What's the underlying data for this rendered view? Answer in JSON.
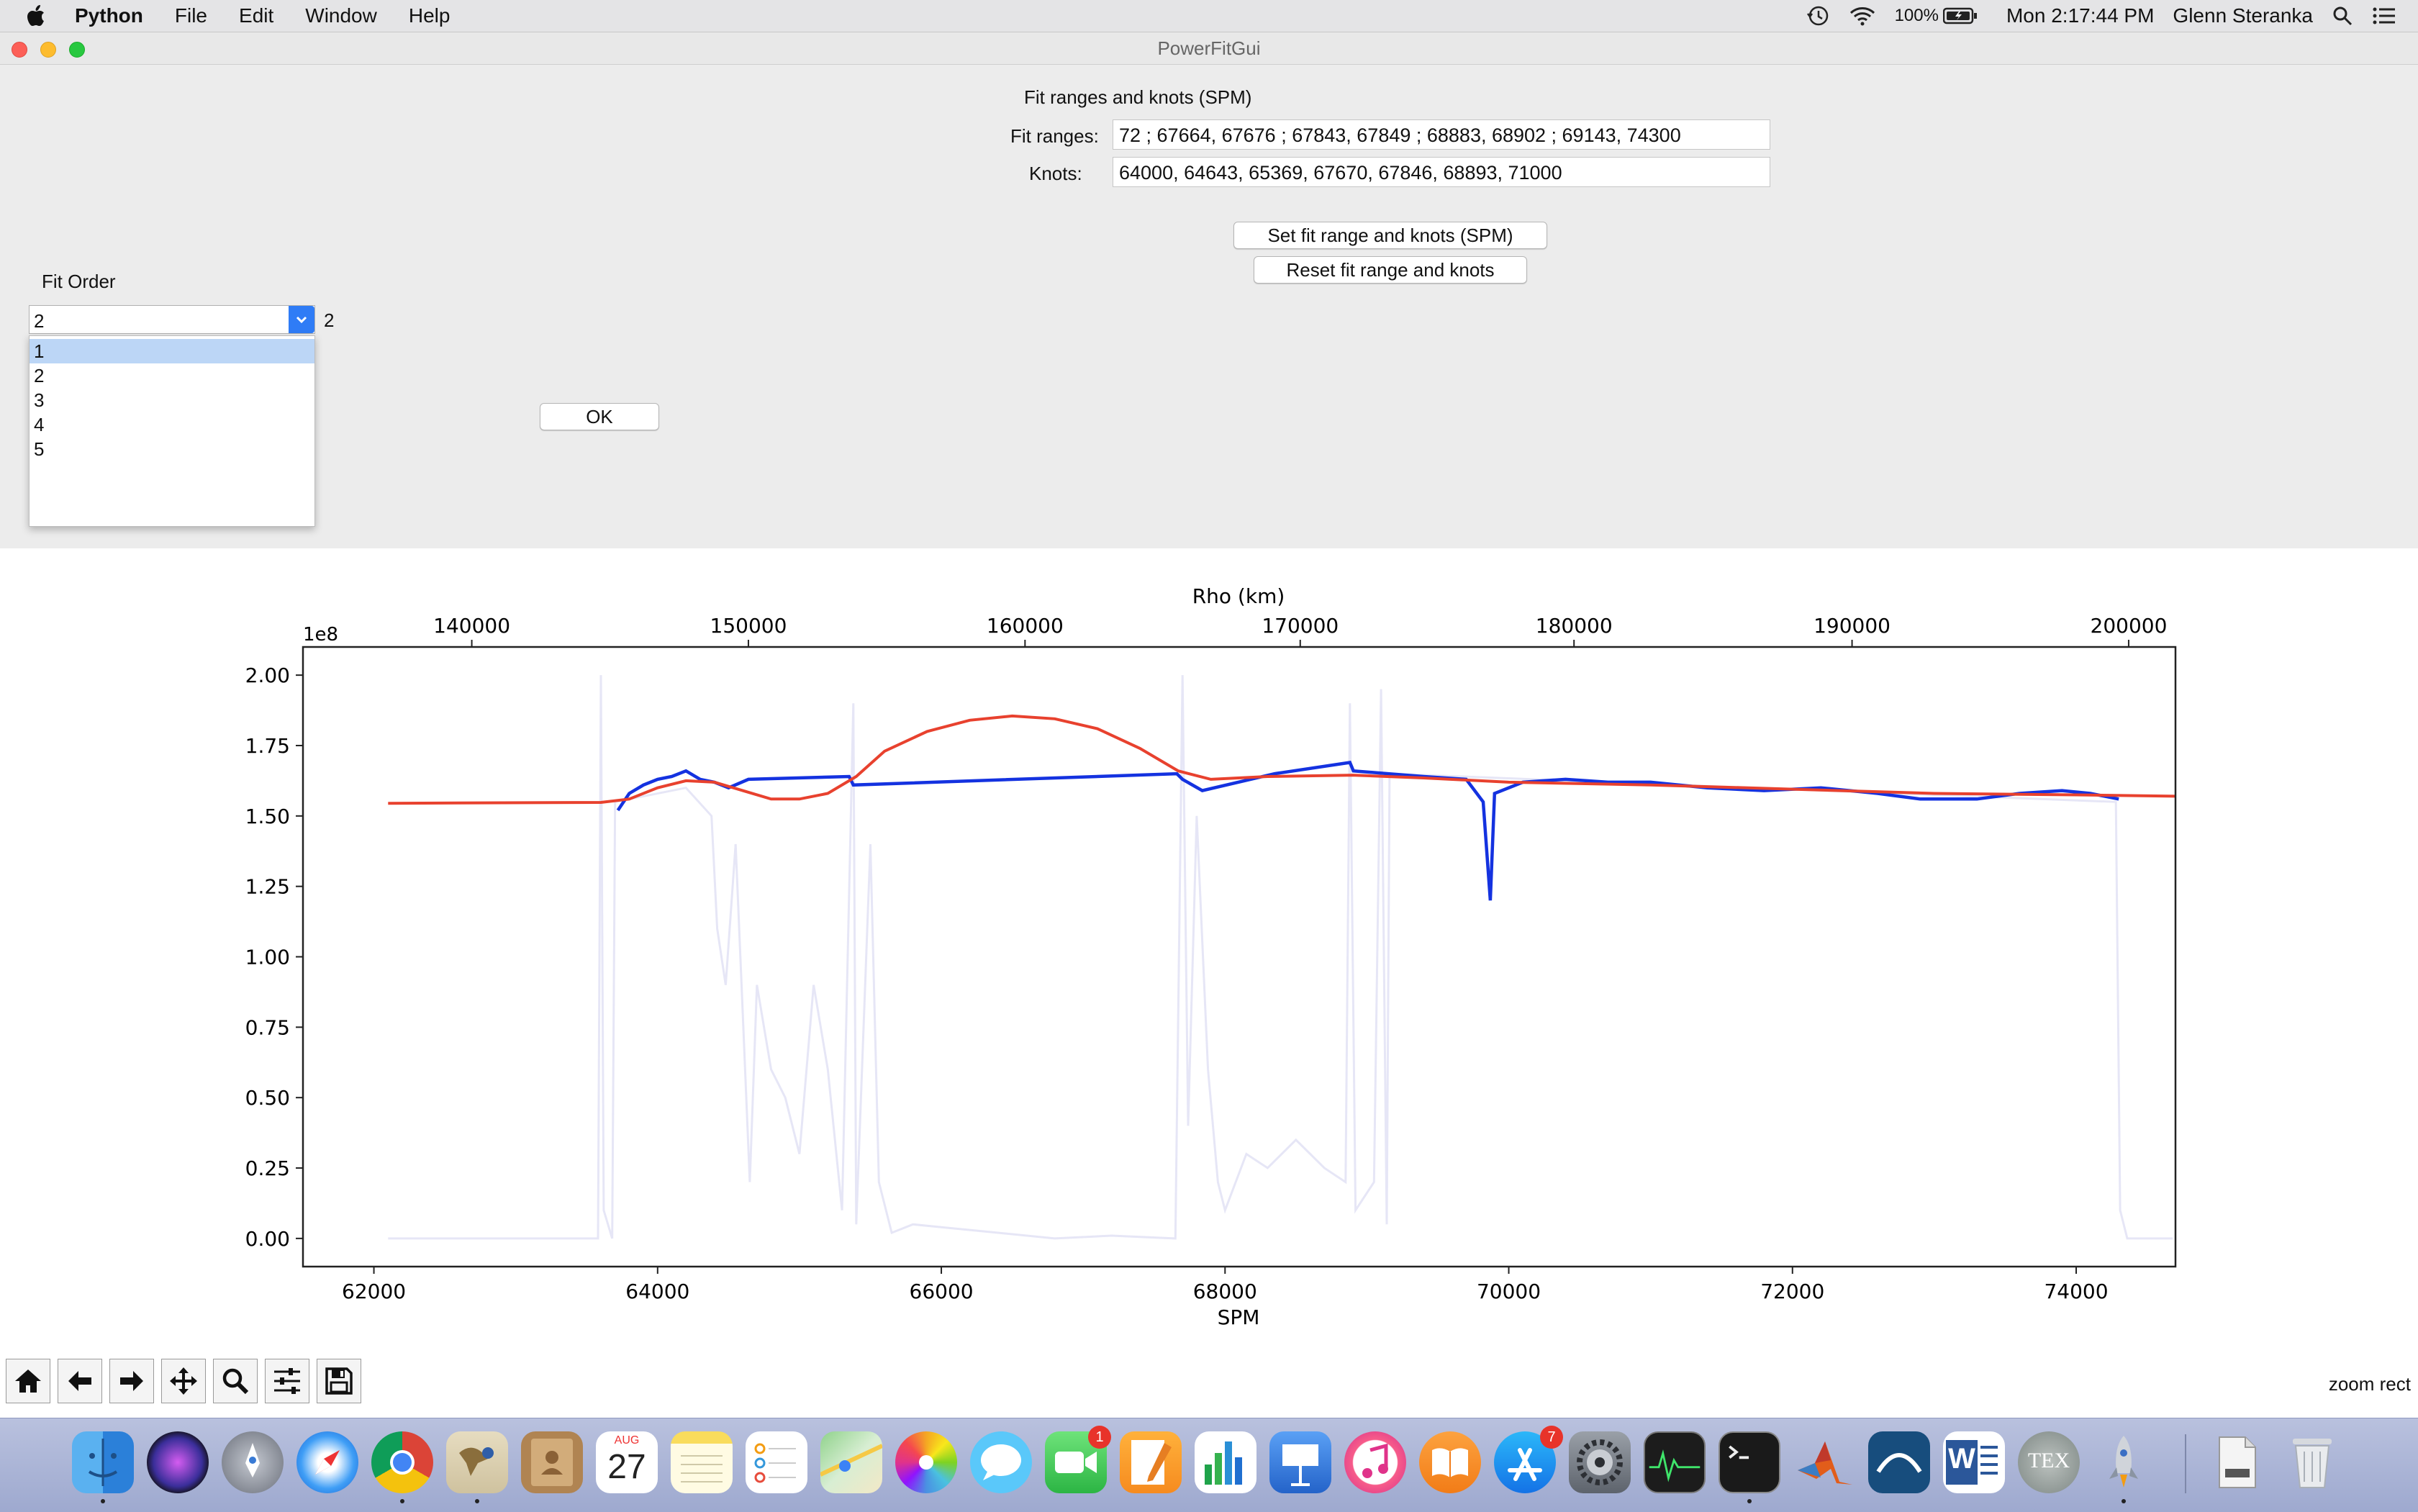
{
  "menubar": {
    "app_name": "Python",
    "menus": [
      "File",
      "Edit",
      "Window",
      "Help"
    ],
    "battery": "100%",
    "clock": "Mon 2:17:44 PM",
    "user": "Glenn Steranka",
    "icons": [
      "time-machine-icon",
      "wifi-icon",
      "battery-icon",
      "spotlight-icon",
      "notification-center-icon"
    ]
  },
  "window": {
    "title": "PowerFitGui"
  },
  "fit_panel": {
    "heading": "Fit ranges and knots (SPM)",
    "fit_ranges_label": "Fit ranges:",
    "fit_ranges_value": "72 ; 67664, 67676 ; 67843, 67849 ; 68883, 68902 ; 69143, 74300",
    "knots_label": "Knots:",
    "knots_value": "64000, 64643, 65369, 67670, 67846, 68893, 71000",
    "set_button": "Set fit range and knots (SPM)",
    "reset_button": "Reset fit range and knots"
  },
  "fit_order": {
    "label": "Fit Order",
    "selected": "2",
    "display_value": "2",
    "options": [
      "1",
      "2",
      "3",
      "4",
      "5"
    ],
    "highlighted": "1"
  },
  "ok_button": "OK",
  "chart_data": {
    "type": "line",
    "title": "",
    "xlabel": "SPM",
    "ylabel": "",
    "top_xlabel": "Rho (km)",
    "y_multiplier": "1e8",
    "xlim": [
      61500,
      74700
    ],
    "ylim": [
      -0.1,
      2.1
    ],
    "x_ticks": [
      62000,
      64000,
      66000,
      68000,
      70000,
      72000,
      74000
    ],
    "x_tick_labels": [
      "62000",
      "64000",
      "66000",
      "68000",
      "70000",
      "72000",
      "74000"
    ],
    "y_ticks": [
      0,
      0.25,
      0.5,
      0.75,
      1.0,
      1.25,
      1.5,
      1.75,
      2.0
    ],
    "y_tick_labels": [
      "0.00",
      "0.25",
      "0.50",
      "0.75",
      "1.00",
      "1.25",
      "1.50",
      "1.75",
      "2.00"
    ],
    "top_ticks": [
      {
        "x": 62690,
        "label": "140000"
      },
      {
        "x": 64640,
        "label": "150000"
      },
      {
        "x": 66590,
        "label": "160000"
      },
      {
        "x": 68530,
        "label": "170000"
      },
      {
        "x": 70460,
        "label": "180000"
      },
      {
        "x": 72420,
        "label": "190000"
      },
      {
        "x": 74370,
        "label": "200000"
      }
    ],
    "grid": false,
    "series": [
      {
        "color": "#e6e6f6",
        "points": [
          [
            62100,
            0.0
          ],
          [
            63580,
            0.0
          ],
          [
            63600,
            2.0
          ],
          [
            63620,
            0.1
          ],
          [
            63680,
            0.0
          ],
          [
            63700,
            1.55
          ],
          [
            64200,
            1.6
          ],
          [
            64380,
            1.5
          ],
          [
            64420,
            1.1
          ],
          [
            64480,
            0.9
          ],
          [
            64550,
            1.4
          ],
          [
            64600,
            0.8
          ],
          [
            64650,
            0.2
          ],
          [
            64700,
            0.9
          ],
          [
            64800,
            0.6
          ],
          [
            64900,
            0.5
          ],
          [
            65000,
            0.3
          ],
          [
            65100,
            0.9
          ],
          [
            65200,
            0.6
          ],
          [
            65300,
            0.1
          ],
          [
            65380,
            1.9
          ],
          [
            65400,
            0.05
          ],
          [
            65500,
            1.4
          ],
          [
            65560,
            0.2
          ],
          [
            65650,
            0.02
          ],
          [
            65800,
            0.05
          ],
          [
            66000,
            0.04
          ],
          [
            66400,
            0.02
          ],
          [
            66800,
            0.0
          ],
          [
            67200,
            0.01
          ],
          [
            67650,
            0.0
          ],
          [
            67700,
            2.0
          ],
          [
            67740,
            0.4
          ],
          [
            67800,
            1.5
          ],
          [
            67880,
            0.6
          ],
          [
            67950,
            0.2
          ],
          [
            68000,
            0.1
          ],
          [
            68150,
            0.3
          ],
          [
            68300,
            0.25
          ],
          [
            68500,
            0.35
          ],
          [
            68700,
            0.25
          ],
          [
            68850,
            0.2
          ],
          [
            68880,
            1.9
          ],
          [
            68920,
            0.1
          ],
          [
            69050,
            0.2
          ],
          [
            69100,
            1.95
          ],
          [
            69140,
            0.05
          ],
          [
            69160,
            1.65
          ],
          [
            74280,
            1.55
          ],
          [
            74310,
            0.1
          ],
          [
            74360,
            0.0
          ],
          [
            74680,
            0.0
          ]
        ]
      },
      {
        "color": "#1432e0",
        "points": [
          [
            63720,
            1.52
          ],
          [
            63800,
            1.58
          ],
          [
            63900,
            1.61
          ],
          [
            64000,
            1.63
          ],
          [
            64100,
            1.64
          ],
          [
            64200,
            1.66
          ],
          [
            64300,
            1.63
          ],
          [
            64400,
            1.62
          ],
          [
            64500,
            1.6
          ],
          [
            64640,
            1.63
          ],
          [
            65350,
            1.64
          ],
          [
            65380,
            1.61
          ],
          [
            67660,
            1.65
          ],
          [
            67700,
            1.63
          ],
          [
            67840,
            1.59
          ],
          [
            68350,
            1.65
          ],
          [
            68880,
            1.69
          ],
          [
            68905,
            1.66
          ],
          [
            69150,
            1.65
          ],
          [
            69400,
            1.64
          ],
          [
            69700,
            1.63
          ],
          [
            69820,
            1.55
          ],
          [
            69870,
            1.2
          ],
          [
            69900,
            1.58
          ],
          [
            70100,
            1.62
          ],
          [
            70400,
            1.63
          ],
          [
            70700,
            1.62
          ],
          [
            71000,
            1.62
          ],
          [
            71400,
            1.6
          ],
          [
            71800,
            1.59
          ],
          [
            72200,
            1.6
          ],
          [
            72600,
            1.58
          ],
          [
            72900,
            1.56
          ],
          [
            73100,
            1.56
          ],
          [
            73300,
            1.56
          ],
          [
            73600,
            1.58
          ],
          [
            73900,
            1.59
          ],
          [
            74100,
            1.58
          ],
          [
            74300,
            1.56
          ]
        ]
      },
      {
        "color": "#e8412e",
        "points": [
          [
            62100,
            1.545
          ],
          [
            63600,
            1.548
          ],
          [
            63800,
            1.56
          ],
          [
            64000,
            1.6
          ],
          [
            64200,
            1.625
          ],
          [
            64400,
            1.62
          ],
          [
            64600,
            1.59
          ],
          [
            64800,
            1.56
          ],
          [
            65000,
            1.56
          ],
          [
            65200,
            1.58
          ],
          [
            65400,
            1.64
          ],
          [
            65600,
            1.73
          ],
          [
            65900,
            1.8
          ],
          [
            66200,
            1.84
          ],
          [
            66500,
            1.855
          ],
          [
            66800,
            1.845
          ],
          [
            67100,
            1.81
          ],
          [
            67400,
            1.74
          ],
          [
            67670,
            1.66
          ],
          [
            67900,
            1.63
          ],
          [
            68300,
            1.64
          ],
          [
            68900,
            1.645
          ],
          [
            69400,
            1.635
          ],
          [
            70000,
            1.62
          ],
          [
            71000,
            1.61
          ],
          [
            72000,
            1.595
          ],
          [
            73000,
            1.58
          ],
          [
            74000,
            1.575
          ],
          [
            74700,
            1.57
          ]
        ]
      }
    ]
  },
  "plot_toolbar": {
    "tools": [
      "home-icon",
      "back-arrow-icon",
      "forward-arrow-icon",
      "pan-icon",
      "zoom-icon",
      "configure-subplots-icon",
      "save-icon"
    ],
    "status": "zoom rect"
  },
  "dock": {
    "calendar_month": "AUG",
    "calendar_day": "27",
    "facetime_badge": "1",
    "appstore_badge": "7",
    "word_letter": "W",
    "tex_label": "TEX",
    "icons": [
      "finder-icon",
      "siri-icon",
      "launchpad-icon",
      "safari-icon",
      "chrome-icon",
      "mail-icon",
      "contacts-icon",
      "calendar-icon",
      "notes-icon",
      "reminders-icon",
      "maps-icon",
      "photos-icon",
      "messages-icon",
      "facetime-icon",
      "pages-icon",
      "numbers-icon",
      "keynote-icon",
      "itunes-icon",
      "books-icon",
      "appstore-icon",
      "system-preferences-icon",
      "activity-monitor-icon",
      "terminal-icon",
      "matlab-icon",
      "xquartz-icon",
      "word-icon",
      "tex-icon",
      "rocket-icon",
      "file-icon",
      "trash-icon"
    ]
  }
}
